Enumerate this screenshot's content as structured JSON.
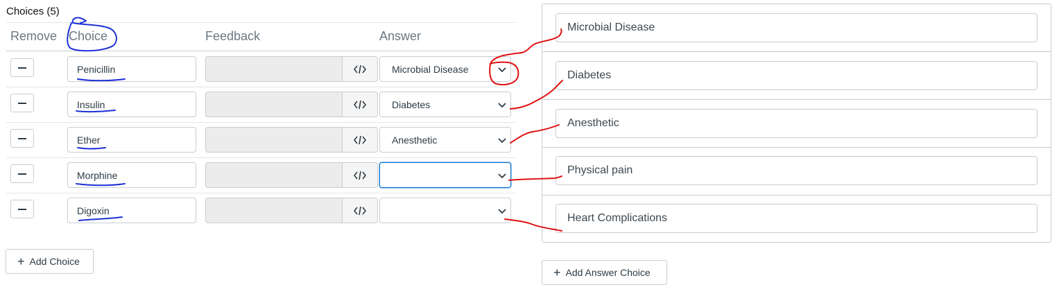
{
  "choices_section": {
    "title": "Choices (5)",
    "columns": {
      "remove": "Remove",
      "choice": "Choice",
      "feedback": "Feedback",
      "answer": "Answer"
    },
    "rows": [
      {
        "choice": "Penicillin",
        "answer": "Microbial Disease"
      },
      {
        "choice": "Insulin",
        "answer": "Diabetes"
      },
      {
        "choice": "Ether",
        "answer": "Anesthetic"
      },
      {
        "choice": "Morphine",
        "answer": ""
      },
      {
        "choice": "Digoxin",
        "answer": ""
      }
    ],
    "add_choice_label": "Add Choice"
  },
  "answers_section": {
    "items": [
      "Microbial Disease",
      "Diabetes",
      "Anesthetic",
      "Physical pain",
      "Heart Complications"
    ],
    "add_answer_label": "Add Answer Choice"
  },
  "icons": {
    "remove": "minus-icon",
    "code": "code-icon",
    "dropdown": "chevron-down-icon",
    "add": "plus-icon"
  },
  "colors": {
    "annotation_blue": "#1d2fd6",
    "annotation_red": "#e01010",
    "focus_border": "#0770c9",
    "disabled_bg": "#ececec"
  }
}
